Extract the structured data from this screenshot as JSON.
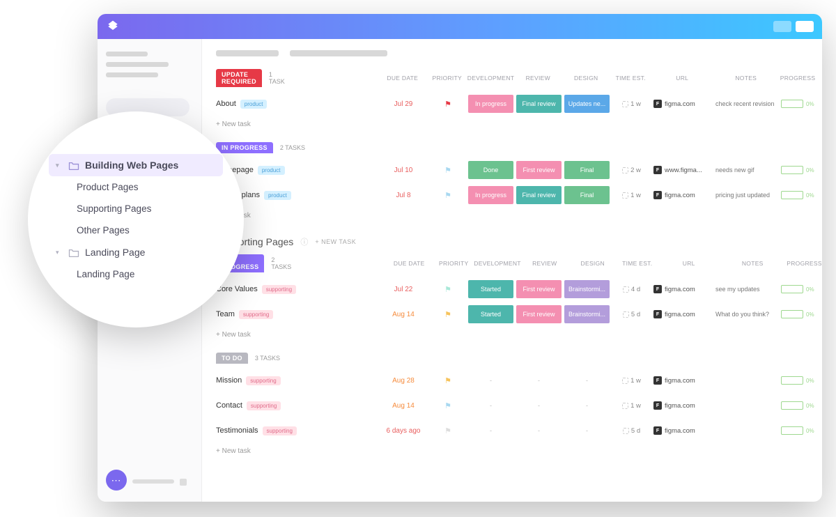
{
  "sidebar_nav": {
    "building": "Building Web Pages",
    "product": "Product Pages",
    "supporting": "Supporting Pages",
    "other": "Other Pages",
    "landing_parent": "Landing Page",
    "landing_child": "Landing Page"
  },
  "columns": {
    "due_date": "DUE DATE",
    "priority": "PRIORITY",
    "development": "DEVELOPMENT",
    "review": "REVIEW",
    "design": "DESIGN",
    "time_est": "TIME EST.",
    "url": "URL",
    "notes": "NOTES",
    "progress": "PROGRESS"
  },
  "labels": {
    "new_task": "+ New task",
    "new_task_upper": "+ NEW TASK",
    "progress_pct": "0%"
  },
  "section2": {
    "title": "Supporting Pages"
  },
  "groups": {
    "update_required": {
      "label": "UPDATE REQUIRED",
      "count": "1 TASK"
    },
    "in_progress": {
      "label": "IN PROGRESS",
      "count": "2 TASKS"
    },
    "in_progress2": {
      "label": "IN PROGRESS",
      "count": "2 TASKS"
    },
    "to_do": {
      "label": "TO DO",
      "count": "3 TASKS"
    }
  },
  "tasks": {
    "about": {
      "name": "About",
      "tag": "product",
      "due": "Jul 29",
      "dev": "In progress",
      "review": "Final review",
      "design": "Updates ne...",
      "time": "1 w",
      "url": "figma.com",
      "notes": "check recent revision"
    },
    "homepage": {
      "name": "Homepage",
      "tag": "product",
      "due": "Jul 10",
      "dev": "Done",
      "review": "First review",
      "design": "Final",
      "time": "2 w",
      "url": "www.figma...",
      "notes": "needs new gif"
    },
    "pricing": {
      "name": "Pricing plans",
      "tag": "product",
      "due": "Jul 8",
      "dev": "In progress",
      "review": "Final review",
      "design": "Final",
      "time": "1 w",
      "url": "figma.com",
      "notes": "pricing just updated"
    },
    "values": {
      "name": "Core Values",
      "tag": "supporting",
      "due": "Jul 22",
      "dev": "Started",
      "review": "First review",
      "design": "Brainstormi...",
      "time": "4 d",
      "url": "figma.com",
      "notes": "see my updates"
    },
    "team": {
      "name": "Team",
      "tag": "supporting",
      "due": "Aug 14",
      "dev": "Started",
      "review": "First review",
      "design": "Brainstormi...",
      "time": "5 d",
      "url": "figma.com",
      "notes": "What do you think?"
    },
    "mission": {
      "name": "Mission",
      "tag": "supporting",
      "due": "Aug 28",
      "time": "1 w",
      "url": "figma.com"
    },
    "contact": {
      "name": "Contact",
      "tag": "supporting",
      "due": "Aug 14",
      "time": "1 w",
      "url": "figma.com"
    },
    "testimonials": {
      "name": "Testimonials",
      "tag": "supporting",
      "due": "6 days ago",
      "time": "5 d",
      "url": "figma.com"
    }
  }
}
